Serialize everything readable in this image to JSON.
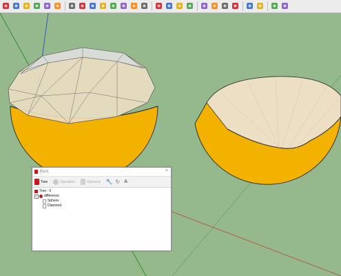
{
  "toolbar": {
    "icons": [
      "select-arrow-icon",
      "pointer-icon",
      "move-icon",
      "rotate-icon",
      "scale-icon",
      "paint-bucket-icon",
      "pushpull-icon",
      "line-icon",
      "arc-icon",
      "rectangle-icon",
      "orbit-icon",
      "pan-icon",
      "zoom-icon",
      "zoom-extents-icon",
      "component-icon",
      "materials-icon",
      "styles-icon",
      "layers-icon",
      "plugin-view-icon",
      "plugin-copy-icon",
      "plugin-export-icon",
      "plugin-x-icon",
      "plugin-bool-icon",
      "plugin-shape-icon",
      "plugin-red-icon",
      "plugin-box-icon"
    ]
  },
  "colors": {
    "viewport_bg": "#95b98d",
    "sphere_yellow": "#f3b100",
    "interior_beige": "#ecdfc4",
    "diamond_glass": "#d9dbd6",
    "axis_green": "#1e9c1e",
    "axis_blue": "#3358b8",
    "axis_red": "#b34a3a",
    "accent_red": "#c8181c"
  },
  "window": {
    "title": "Bool",
    "close_glyph": "×",
    "buttons": [
      {
        "label": "Tree",
        "enabled": true
      },
      {
        "label": "Operation",
        "enabled": false
      },
      {
        "label": "Operand",
        "enabled": false
      }
    ],
    "letter_button": "A",
    "tree": {
      "root": "Tree - 0",
      "operation": "difference",
      "children": [
        "Sphere",
        "Diamond"
      ]
    }
  }
}
